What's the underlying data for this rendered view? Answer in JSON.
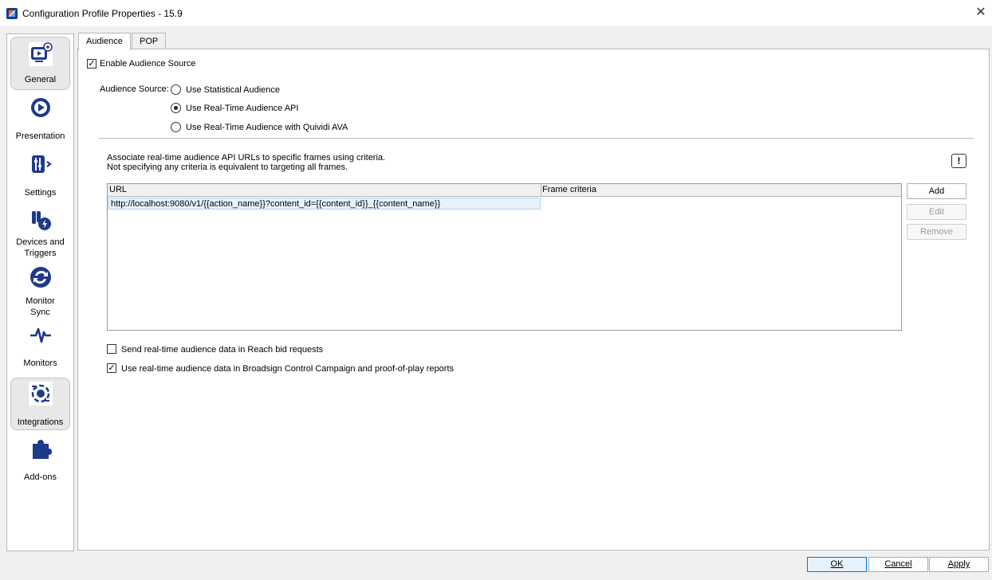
{
  "window": {
    "title": "Configuration Profile Properties - 15.9",
    "close_glyph": "✕"
  },
  "nav": {
    "items": [
      {
        "label": "General",
        "icon": "monitor-gear-icon",
        "active": true
      },
      {
        "label": "Presentation",
        "icon": "presentation-icon",
        "active": false
      },
      {
        "label": "Settings",
        "icon": "settings-sliders-icon",
        "active": false
      },
      {
        "label": "Devices and Triggers",
        "icon": "devices-triggers-icon",
        "active": false
      },
      {
        "label": "Monitor Sync",
        "icon": "sync-icon",
        "active": false
      },
      {
        "label": "Monitors",
        "icon": "heartbeat-icon",
        "active": false
      },
      {
        "label": "Integrations",
        "icon": "integrations-icon",
        "active": true
      },
      {
        "label": "Add-ons",
        "icon": "puzzle-icon",
        "active": false
      }
    ]
  },
  "tabs": [
    {
      "label": "Audience",
      "active": true
    },
    {
      "label": "POP",
      "active": false
    }
  ],
  "audience": {
    "enable_label": "Enable Audience Source",
    "enable_checked": true,
    "source_label": "Audience Source:",
    "sources": [
      {
        "label": "Use Statistical Audience",
        "selected": false
      },
      {
        "label": "Use Real-Time Audience API",
        "selected": true
      },
      {
        "label": "Use Real-Time Audience with Quividi AVA",
        "selected": false
      }
    ],
    "description_line1": "Associate real-time audience API URLs to specific frames using criteria.",
    "description_line2": "Not specifying any criteria is equivalent to targeting all frames.",
    "warning_glyph": "!",
    "grid": {
      "columns": [
        "URL",
        "Frame criteria"
      ],
      "rows": [
        {
          "url": "http://localhost:9080/v1/{{action_name}}?content_id={{content_id}}_{{content_name}}",
          "criteria": ""
        }
      ]
    },
    "buttons": {
      "add": "Add",
      "edit": "Edit",
      "remove": "Remove"
    },
    "reach_label": "Send real-time audience data in Reach bid requests",
    "reach_checked": false,
    "control_label": "Use real-time audience data in Broadsign Control Campaign and proof-of-play reports",
    "control_checked": true
  },
  "footer": {
    "ok": "OK",
    "cancel": "Cancel",
    "apply": "Apply"
  },
  "colors": {
    "icon_primary": "#1e3a8a",
    "selection": "#e8f2fb",
    "accent": "#0078d7"
  }
}
